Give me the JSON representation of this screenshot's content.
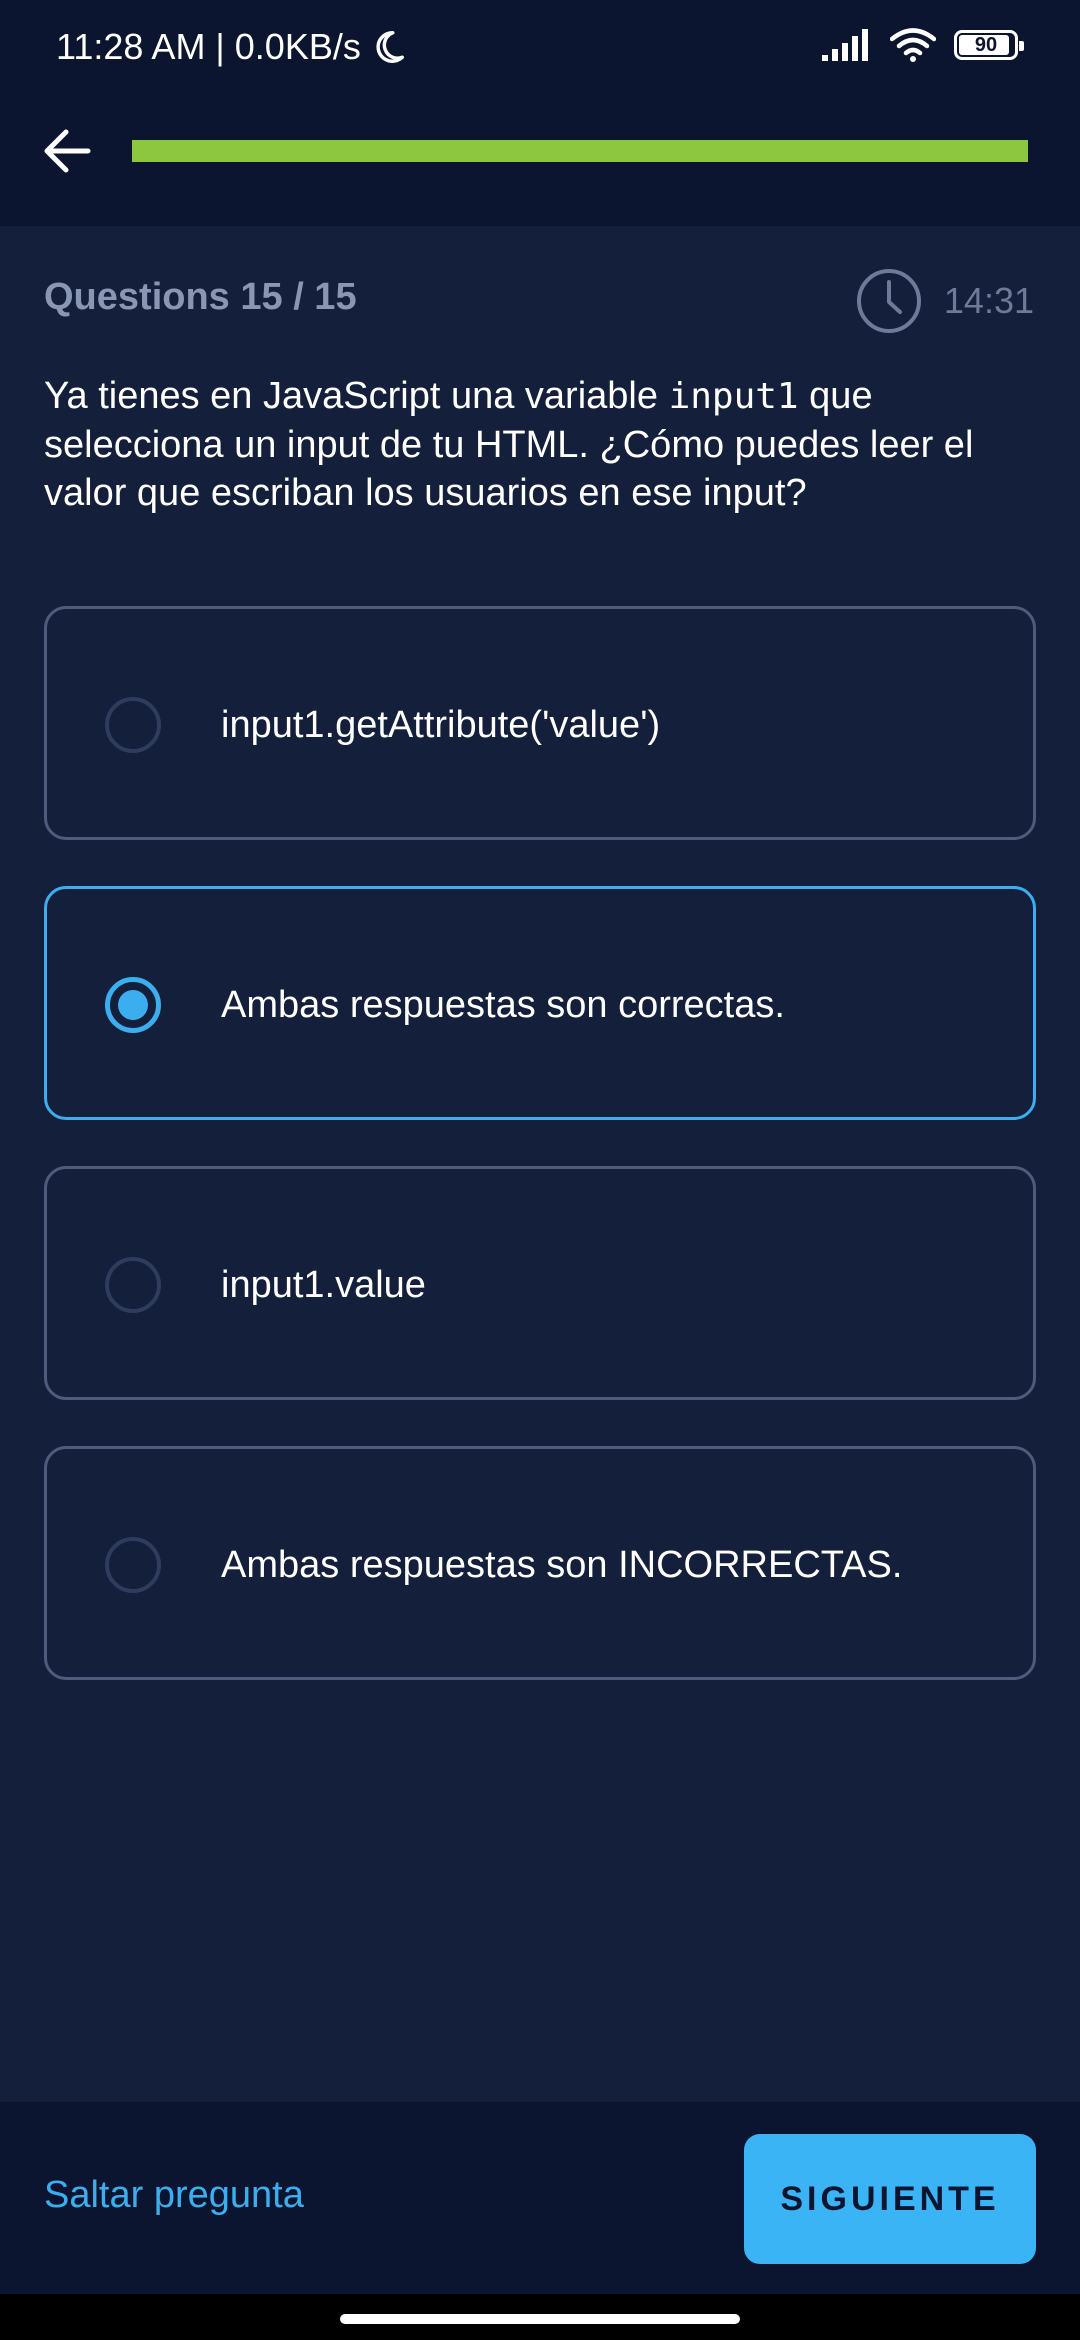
{
  "status_bar": {
    "time": "11:28 AM | 0.0KB/s",
    "battery": "90"
  },
  "header": {
    "progress": 1.0,
    "progress_color": "#8dc63f"
  },
  "quiz": {
    "counter": "Questions 15 / 15",
    "timer": "14:31",
    "question_prefix": "Ya tienes en JavaScript una variable",
    "question_code": "input1",
    "question_suffix": "que selecciona un input de tu HTML. ¿Cómo puedes leer el valor que escriban los usuarios en ese input?",
    "options": [
      {
        "label": "input1.getAttribute('value')",
        "selected": false
      },
      {
        "label": "Ambas respuestas son correctas.",
        "selected": true
      },
      {
        "label": "input1.value",
        "selected": false
      },
      {
        "label": "Ambas respuestas son INCORRECTAS.",
        "selected": false
      }
    ]
  },
  "footer": {
    "skip_label": "Saltar pregunta",
    "next_label": "SIGUIENTE"
  },
  "colors": {
    "background": "#141f3b",
    "header_bg": "#0c1530",
    "accent": "#3aaeee",
    "progress": "#8dc63f"
  },
  "icons": {
    "back": "arrow-left-icon",
    "timer": "clock-icon",
    "signal": "signal-icon",
    "wifi": "wifi-icon",
    "battery": "battery-icon",
    "moon": "moon-icon"
  }
}
